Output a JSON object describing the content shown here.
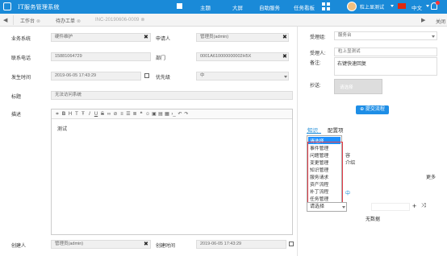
{
  "app": {
    "title": "IT服务管理系统"
  },
  "topnav": {
    "items": [
      "主题",
      "大屏",
      "自助服务",
      "任务看板"
    ],
    "user": "粒上显测试",
    "lang": "中文"
  },
  "tabs": [
    {
      "label": "工作台"
    },
    {
      "label": "待办工单"
    },
    {
      "label": "INC-20190606-0009"
    }
  ],
  "close_tab": "关闭",
  "form": {
    "business_system": {
      "label": "业务系统",
      "value": "硬件维护"
    },
    "applicant": {
      "label": "申请人",
      "value": "管理员(admin)"
    },
    "phone": {
      "label": "联系电话",
      "value": "15881064729"
    },
    "department": {
      "label": "部门",
      "value": "0001A610000000002H5X"
    },
    "occur_time": {
      "label": "发生时间",
      "value": "2019-06-05 17:43:29"
    },
    "priority": {
      "label": "优先级",
      "value": "中"
    },
    "subject": {
      "label": "标题",
      "value": "无法访问系统"
    },
    "description": {
      "label": "描述",
      "value": "测试"
    },
    "creator": {
      "label": "创建人",
      "value": "管理员(admin)"
    },
    "create_time": {
      "label": "创建时间",
      "value": "2019-06-05 17:43:29"
    }
  },
  "right": {
    "group": {
      "label": "受理组:",
      "value": "服务台"
    },
    "handler": {
      "label": "受理人:",
      "value": "粒上显测试"
    },
    "remark": {
      "label": "备注:",
      "value": "右键快速回复"
    },
    "cc": {
      "label": "抄送:",
      "placeholder": "请选择"
    },
    "submit": "提交流程",
    "tabs": [
      "知识",
      "配置项"
    ],
    "behind_texts": [
      "容",
      "介绍",
      "更多",
      "中"
    ],
    "dropdown": [
      "请选择",
      "事件管理",
      "问题管理",
      "变更管理",
      "知识管理",
      "服务请求",
      "资产流程",
      "补丁流程",
      "任务管理"
    ],
    "bottom_select": "请选择",
    "no_data": "无数据"
  }
}
